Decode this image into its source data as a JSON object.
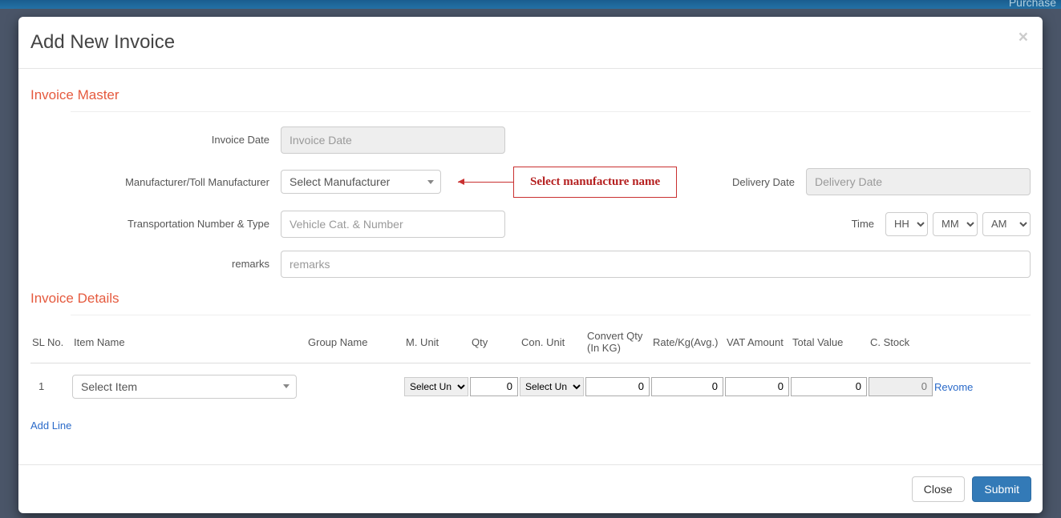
{
  "topnav": {
    "link": "Purchase"
  },
  "modal": {
    "title": "Add New Invoice",
    "close_icon": "×"
  },
  "sections": {
    "master_title": "Invoice Master",
    "details_title": "Invoice Details"
  },
  "labels": {
    "invoice_date": "Invoice Date",
    "manufacturer": "Manufacturer/Toll Manufacturer",
    "delivery_date": "Delivery Date",
    "transport": "Transportation Number & Type",
    "time": "Time",
    "remarks": "remarks"
  },
  "placeholders": {
    "invoice_date": "Invoice Date",
    "delivery_date": "Delivery Date",
    "vehicle": "Vehicle Cat. & Number",
    "remarks": "remarks"
  },
  "manufacturer_select": {
    "selected": "Select Manufacturer"
  },
  "callout": {
    "text": "Select manufacture name"
  },
  "time_selects": {
    "hh": "HH",
    "mm": "MM",
    "ampm": "AM"
  },
  "table": {
    "headers": {
      "sl": "SL No.",
      "item": "Item Name",
      "group": "Group Name",
      "munit": "M. Unit",
      "qty": "Qty",
      "conunit": "Con. Unit",
      "convertqty_line1": "Convert Qty",
      "convertqty_line2": "(In KG)",
      "rate": "Rate/Kg(Avg.)",
      "vat": "VAT Amount",
      "total": "Total Value",
      "cstock": "C. Stock"
    },
    "rows": [
      {
        "sl": "1",
        "item_selected": "Select Item",
        "group": "",
        "munit_selected": "Select Un",
        "qty": "0",
        "conunit_selected": "Select Un",
        "convertqty": "0",
        "rate": "0",
        "vat": "0",
        "total": "0",
        "cstock": "0",
        "remove_label": "Revome"
      }
    ],
    "add_line_label": "Add Line"
  },
  "footer": {
    "close": "Close",
    "submit": "Submit"
  }
}
